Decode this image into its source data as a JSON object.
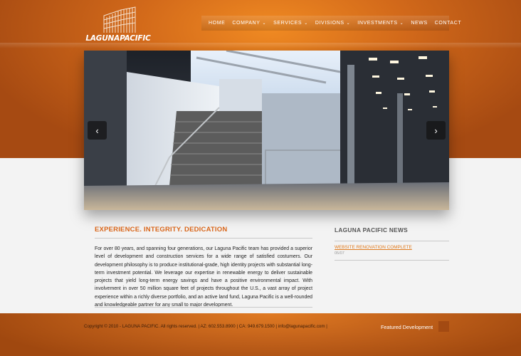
{
  "brand": {
    "logo_text": "LAGUNAPACIFIC",
    "accent_color": "#d9661a"
  },
  "nav": {
    "items": [
      {
        "label": "HOME",
        "dropdown": false
      },
      {
        "label": "COMPANY",
        "dropdown": true
      },
      {
        "label": "SERVICES",
        "dropdown": true
      },
      {
        "label": "DIVISIONS",
        "dropdown": true
      },
      {
        "label": "INVESTMENTS",
        "dropdown": true
      },
      {
        "label": "NEWS",
        "dropdown": false
      },
      {
        "label": "CONTACT",
        "dropdown": false
      }
    ],
    "caret": "⌄"
  },
  "slider": {
    "prev_icon": "‹",
    "next_icon": "›"
  },
  "main": {
    "headline": "EXPERIENCE. INTEGRITY. DEDICATION",
    "body": "For over 80 years, and spanning four generations, our Laguna Pacific team has provided a superior level of development and construction services for a wide range of satisfied costumers. Our development philosophy is to produce institutional-grade, high identity projects with substantial long-term investment potential. We leverage our expertise in renewable energy to deliver sustainable projects that yield long-term energy savings and have a positive environmental impact. With involvement in over 50 million square feet of projects throughout the U.S., a vast array of project experience within a richly diverse portfolio, and an active land fund, Laguna Pacific is a well-rounded and knowledgeable partner for any small to major development."
  },
  "news": {
    "title": "LAGUNA PACIFIC NEWS",
    "items": [
      {
        "label": "WEBSITE RENOVATION COMPLETE",
        "date": "05/07"
      }
    ]
  },
  "footer": {
    "text": "Copyright © 2010 - LAGUNA PACIFIC. All rights reserved. | AZ: 602.553.8900 | CA: 949.679.1500 | info@lagunapacific.com |",
    "featured_label": "Featured Development"
  }
}
